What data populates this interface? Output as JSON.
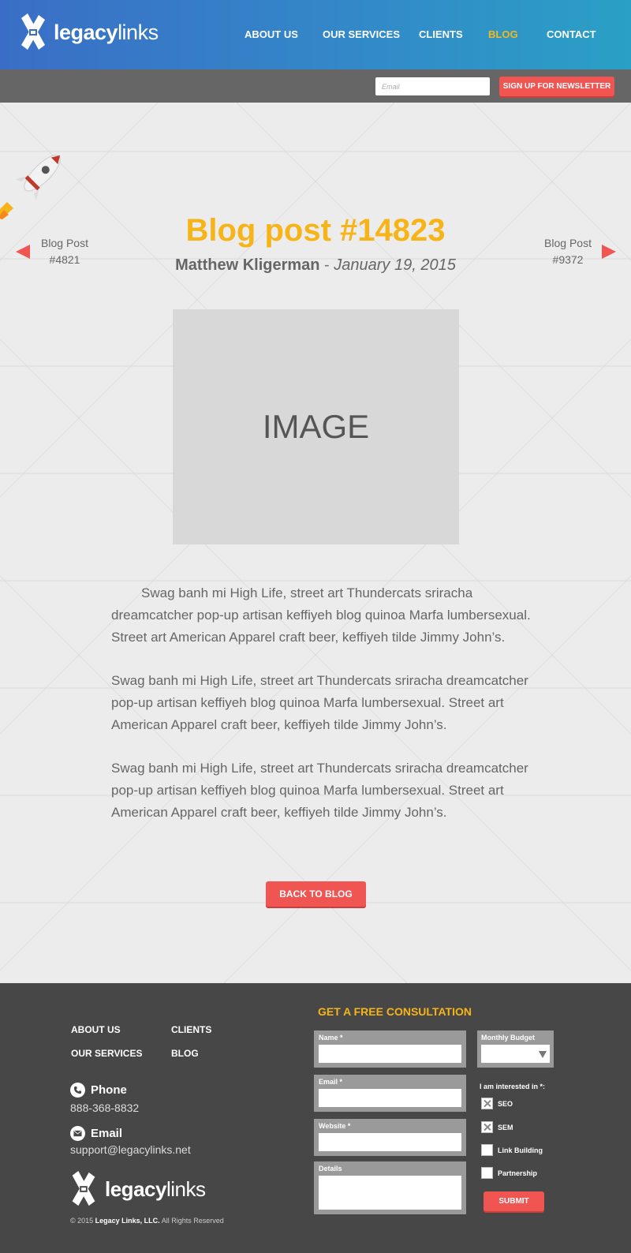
{
  "header": {
    "logo": {
      "bold": "legacy",
      "light": "links"
    },
    "nav": [
      {
        "label": "ABOUT US"
      },
      {
        "label": "OUR SERVICES"
      },
      {
        "label": "CLIENTS"
      },
      {
        "label": "BLOG",
        "active": true
      },
      {
        "label": "CONTACT"
      }
    ]
  },
  "newsletter": {
    "email_placeholder": "Email",
    "signup_label": "SIGN UP FOR NEWSLETTER"
  },
  "post": {
    "title": "Blog post #14823",
    "author": "Matthew Kligerman",
    "separator": " - ",
    "date": "January 19, 2015",
    "prev": {
      "line1": "Blog Post",
      "line2": "#4821"
    },
    "next": {
      "line1": "Blog Post",
      "line2": "#9372"
    },
    "image_placeholder": "IMAGE",
    "paragraphs": [
      "Swag banh mi High Life, street art Thundercats sriracha dreamcatcher pop-up artisan keffiyeh blog quinoa Marfa lumbersexual. Street art American Apparel craft beer, keffiyeh tilde Jimmy John’s.",
      "Swag banh mi High Life, street art Thundercats sriracha dreamcatcher pop-up artisan keffiyeh blog quinoa Marfa lumbersexual. Street art American Apparel craft beer, keffiyeh tilde Jimmy John’s.",
      "Swag banh mi High Life, street art Thundercats sriracha dreamcatcher pop-up artisan keffiyeh blog quinoa Marfa lumbersexual. Street art American Apparel craft beer, keffiyeh tilde Jimmy John’s."
    ],
    "back_label": "BACK TO BLOG"
  },
  "footer": {
    "links": {
      "about": "ABOUT US",
      "clients": "CLIENTS",
      "services": "OUR SERVICES",
      "blog": "BLOG"
    },
    "phone": {
      "label": "Phone",
      "value": "888-368-8832"
    },
    "email": {
      "label": "Email",
      "value": "support@legacylinks.net"
    },
    "logo": {
      "bold": "legacy",
      "light": "links"
    },
    "copyright": {
      "prefix": "© 2015 ",
      "company": "Legacy Links, LLC.",
      "suffix": " All Rights Reserved"
    },
    "form": {
      "title": "GET A FREE CONSULTATION",
      "name_label": "Name *",
      "email_label": "Email *",
      "website_label": "Website *",
      "details_label": "Details",
      "budget_label": "Monthly Budget",
      "interest_label": "I am interested in *:",
      "options": [
        {
          "label": "SEO",
          "checked": true
        },
        {
          "label": "SEM",
          "checked": true
        },
        {
          "label": "Link Building",
          "checked": false
        },
        {
          "label": "Partnership",
          "checked": false
        }
      ],
      "submit_label": "SUBMIT"
    }
  },
  "colors": {
    "accent_red": "#f05552",
    "accent_yellow": "#f7b418",
    "header_blue_start": "#3a6ec6",
    "header_blue_end": "#2aa0c6",
    "footer_bg": "#474747"
  }
}
